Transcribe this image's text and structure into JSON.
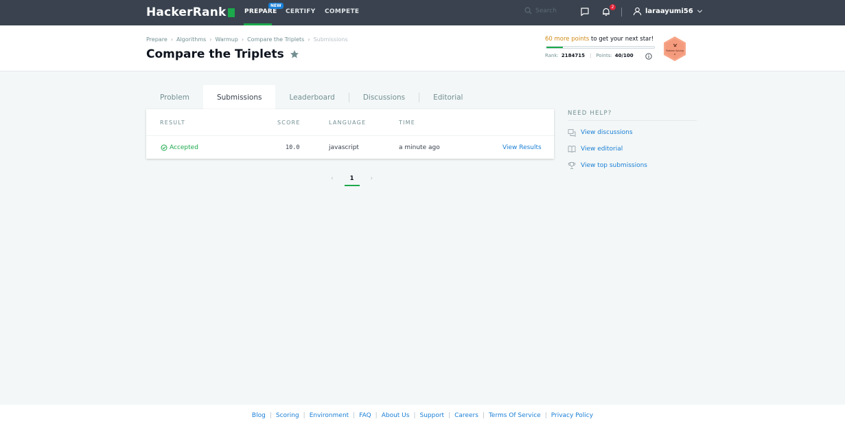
{
  "nav": {
    "logo": "HackerRank",
    "links": [
      {
        "label": "PREPARE"
      },
      {
        "label": "CERTIFY"
      },
      {
        "label": "COMPETE"
      }
    ],
    "new_badge": "NEW",
    "search_placeholder": "Search",
    "notifications_count": "2",
    "username": "laraayumi56"
  },
  "header": {
    "breadcrumb": [
      "Prepare",
      "Algorithms",
      "Warmup",
      "Compare the Triplets",
      "Submissions"
    ],
    "title": "Compare the Triplets",
    "points_highlight": "60 more points",
    "points_rest": " to get your next star!",
    "progress_fraction": 0.15,
    "rank_label": "Rank:",
    "rank_value": "2184715",
    "points_label": "Points:",
    "points_value": "40/100",
    "badge_label": "Problem Solving"
  },
  "tabs": [
    {
      "label": "Problem"
    },
    {
      "label": "Submissions"
    },
    {
      "label": "Leaderboard"
    },
    {
      "label": "Discussions"
    },
    {
      "label": "Editorial"
    }
  ],
  "table": {
    "headers": {
      "result": "RESULT",
      "score": "SCORE",
      "language": "LANGUAGE",
      "time": "TIME"
    },
    "rows": [
      {
        "result": "Accepted",
        "score": "10.0",
        "language": "javascript",
        "time": "a minute ago",
        "action": "View Results"
      }
    ]
  },
  "pagination": {
    "current": "1"
  },
  "help": {
    "title": "NEED HELP?",
    "items": [
      {
        "label": "View discussions"
      },
      {
        "label": "View editorial"
      },
      {
        "label": "View top submissions"
      }
    ]
  },
  "footer": {
    "links": [
      "Blog",
      "Scoring",
      "Environment",
      "FAQ",
      "About Us",
      "Support",
      "Careers",
      "Terms Of Service",
      "Privacy Policy"
    ]
  },
  "colors": {
    "nav_bg": "#39424e",
    "accent_green": "#1ba94c",
    "link_blue": "#1a7fd6",
    "points_orange": "#d18b16"
  }
}
